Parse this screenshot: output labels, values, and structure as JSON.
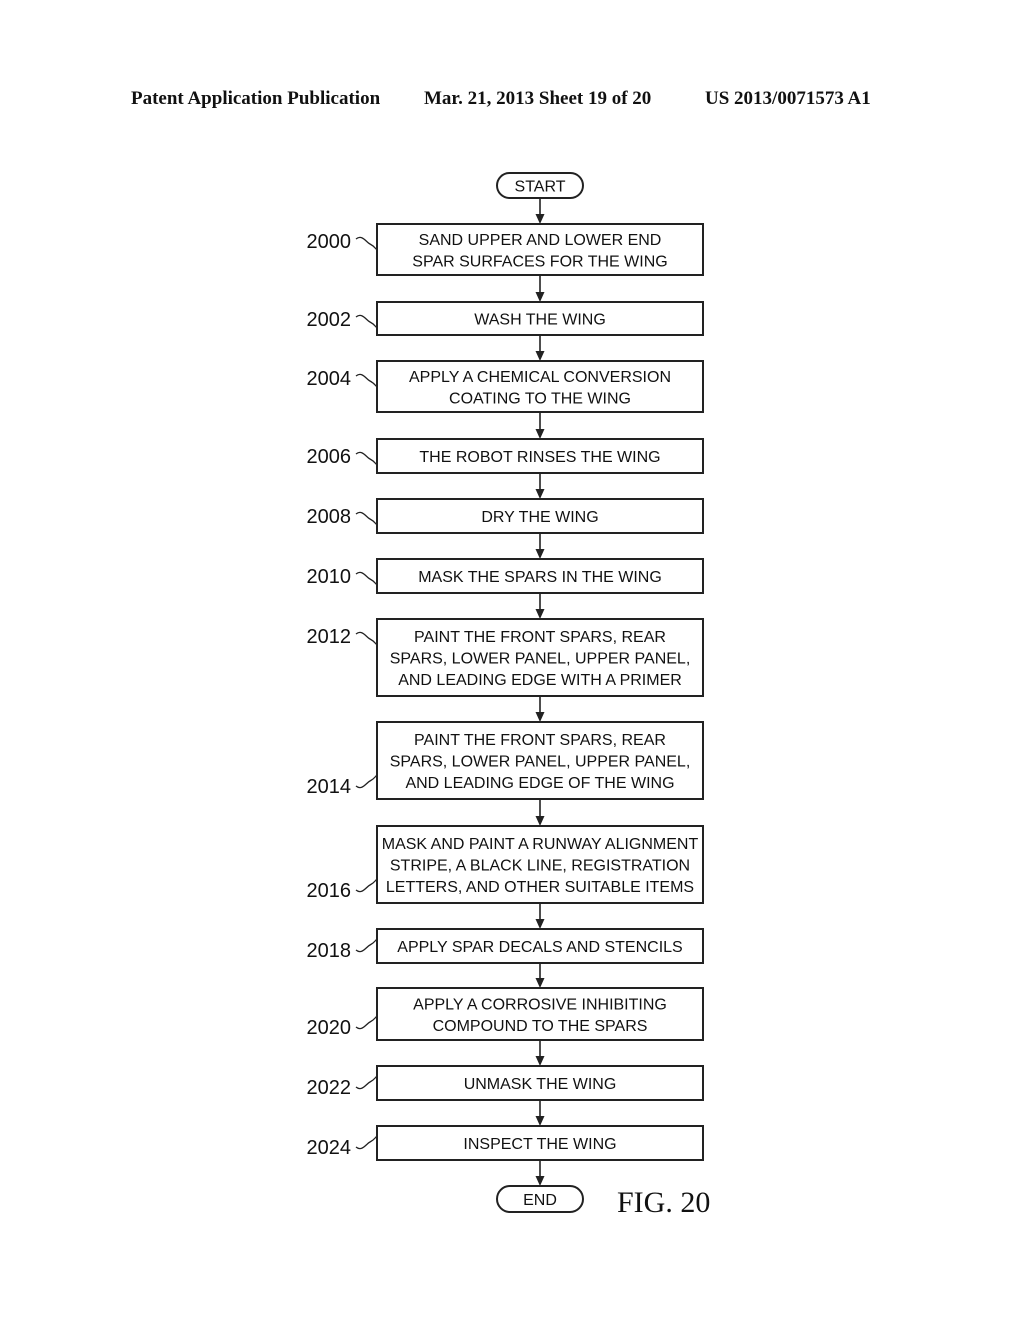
{
  "header": {
    "publication": "Patent Application Publication",
    "date_sheet": "Mar. 21, 2013  Sheet 19 of 20",
    "number": "US 2013/0071573 A1"
  },
  "flowchart": {
    "start_label": "START",
    "end_label": "END",
    "figure_label": "FIG. 20",
    "steps": [
      {
        "ref": "2000",
        "lines": [
          "SAND UPPER AND LOWER END",
          "SPAR SURFACES FOR THE WING"
        ]
      },
      {
        "ref": "2002",
        "lines": [
          "WASH THE WING"
        ]
      },
      {
        "ref": "2004",
        "lines": [
          "APPLY A CHEMICAL CONVERSION",
          "COATING TO THE WING"
        ]
      },
      {
        "ref": "2006",
        "lines": [
          "THE ROBOT RINSES THE WING"
        ]
      },
      {
        "ref": "2008",
        "lines": [
          "DRY THE WING"
        ]
      },
      {
        "ref": "2010",
        "lines": [
          "MASK THE SPARS IN THE WING"
        ]
      },
      {
        "ref": "2012",
        "lines": [
          "PAINT THE FRONT SPARS, REAR",
          "SPARS, LOWER PANEL, UPPER PANEL,",
          "AND LEADING EDGE WITH A PRIMER"
        ]
      },
      {
        "ref": "2014",
        "lines": [
          "PAINT THE FRONT SPARS, REAR",
          "SPARS, LOWER PANEL, UPPER PANEL,",
          "AND LEADING EDGE OF THE WING"
        ]
      },
      {
        "ref": "2016",
        "lines": [
          "MASK AND PAINT A RUNWAY ALIGNMENT",
          "STRIPE, A BLACK LINE, REGISTRATION",
          "LETTERS, AND OTHER SUITABLE ITEMS"
        ]
      },
      {
        "ref": "2018",
        "lines": [
          "APPLY SPAR DECALS AND STENCILS"
        ]
      },
      {
        "ref": "2020",
        "lines": [
          "APPLY A CORROSIVE INHIBITING",
          "COMPOUND TO THE SPARS"
        ]
      },
      {
        "ref": "2022",
        "lines": [
          "UNMASK THE WING"
        ]
      },
      {
        "ref": "2024",
        "lines": [
          "INSPECT THE WING"
        ]
      }
    ]
  }
}
